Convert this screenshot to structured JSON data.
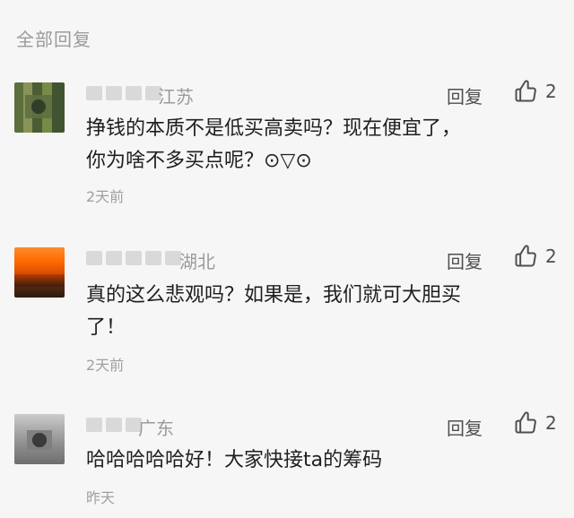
{
  "section_title": "全部回复",
  "comments": [
    {
      "location": "江苏",
      "reply_label": "回复",
      "like_count": "2",
      "text_lines": [
        "挣钱的本质不是低买高卖吗？现在便宜了，",
        "你为啥不多买点呢？⊙▽⊙"
      ],
      "time": "2天前"
    },
    {
      "location": "湖北",
      "reply_label": "回复",
      "like_count": "2",
      "text_lines": [
        "真的这么悲观吗？如果是，我们就可大胆买",
        "了！"
      ],
      "time": "2天前"
    },
    {
      "location": "广东",
      "reply_label": "回复",
      "like_count": "2",
      "text_lines": [
        "哈哈哈哈哈好！大家快接ta的筹码"
      ],
      "time": "昨天"
    }
  ]
}
